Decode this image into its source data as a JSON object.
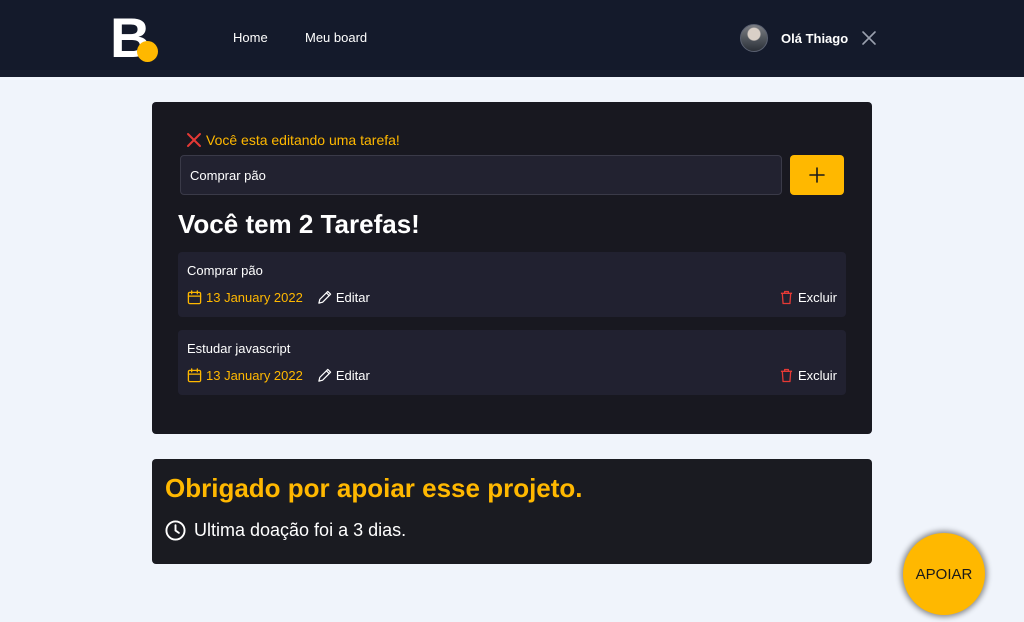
{
  "colors": {
    "header_bg": "#141a2b",
    "accent": "#ffb800",
    "danger": "#e53935",
    "page_bg": "#f0f4fb",
    "card_bg": "#181820",
    "task_item_bg": "#212130"
  },
  "header": {
    "logo_letter": "B",
    "nav": [
      {
        "label": "Home"
      },
      {
        "label": "Meu board"
      }
    ],
    "greeting": "Olá Thiago",
    "logout_icon": "close-icon"
  },
  "board": {
    "edit_notice": "Você esta editando uma tarefa!",
    "input": {
      "value": "Comprar pão",
      "placeholder": ""
    },
    "add_icon": "plus-icon",
    "task_count_title": "Você tem 2 Tarefas!",
    "tasks": [
      {
        "name": "Comprar pão",
        "date": "13 January 2022",
        "edit_label": "Editar",
        "delete_label": "Excluir"
      },
      {
        "name": "Estudar javascript",
        "date": "13 January 2022",
        "edit_label": "Editar",
        "delete_label": "Excluir"
      }
    ]
  },
  "support": {
    "title": "Obrigado por apoiar esse projeto.",
    "last_donation": "Ultima doação foi a 3 dias.",
    "button_label": "APOIAR"
  }
}
